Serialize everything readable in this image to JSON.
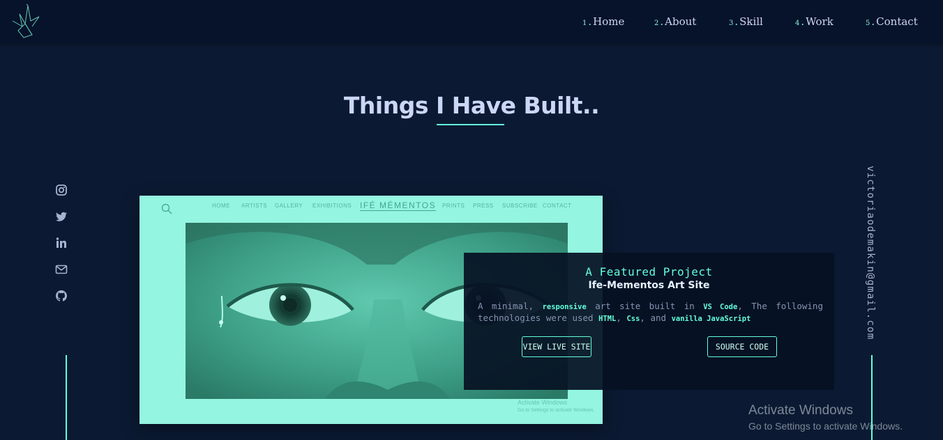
{
  "header": {
    "nav": [
      {
        "num": "1",
        "label": "Home"
      },
      {
        "num": "2",
        "label": "About"
      },
      {
        "num": "3",
        "label": "Skill"
      },
      {
        "num": "4",
        "label": "Work"
      },
      {
        "num": "5",
        "label": "Contact"
      }
    ]
  },
  "section": {
    "title": "Things I Have Built.."
  },
  "social": {
    "icons": [
      "instagram-icon",
      "twitter-icon",
      "linkedin-icon",
      "mail-icon",
      "github-icon"
    ]
  },
  "email": "victoriaodemakin@gmail.com",
  "project": {
    "screenshot": {
      "nav": [
        "HOME",
        "ARTISTS",
        "GALLERY",
        "EXHIBITIONS",
        "PRINTS",
        "PRESS",
        "SUBSCRIBE",
        "CONTACT"
      ],
      "brand": "IFÉ MÉMENTOS",
      "watermark_title": "Activate Windows",
      "watermark_sub": "Go to Settings to activate Windows."
    },
    "overline": "A Featured Project",
    "title": "Ife-Mementos Art Site",
    "desc": {
      "t1": "A minimal, ",
      "h1": "responsive",
      "t2": " art site built in ",
      "h2": "VS Code",
      "t3": ", The following technologies were used ",
      "h3": "HTML",
      "t4": ", ",
      "h4": "Css",
      "t5": ", and ",
      "h5": "vanilla JavaScript"
    },
    "live_label": "VIEW LIVE SITE",
    "source_label": "SOURCE CODE"
  },
  "windows": {
    "title": "Activate Windows",
    "subtitle": "Go to Settings to activate Windows."
  },
  "colors": {
    "background": "#0b1a32",
    "accent": "#64ffda",
    "text": "#ccd6f6",
    "image_tint": "#94f5e0"
  }
}
